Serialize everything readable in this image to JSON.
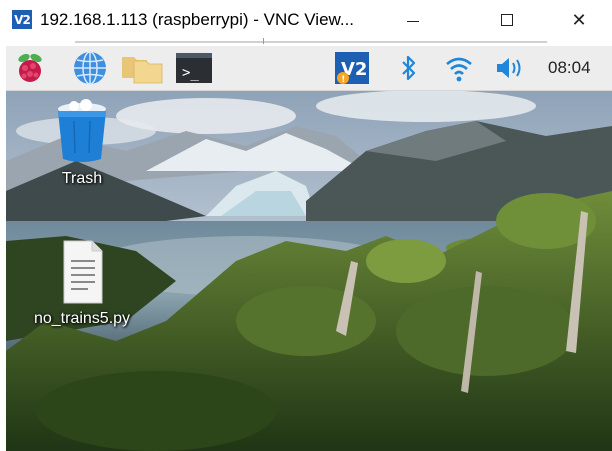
{
  "window": {
    "app_icon_text": "V2",
    "title": "192.168.1.113 (raspberrypi) - VNC View...",
    "minimize_label": "",
    "maximize_label": "",
    "close_label": "✕"
  },
  "panel": {
    "items": [
      {
        "name": "raspberry-menu-icon"
      },
      {
        "name": "web-browser-icon"
      },
      {
        "name": "file-manager-icon"
      },
      {
        "name": "terminal-icon",
        "glyph": ">_"
      },
      {
        "name": "vnc-server-icon"
      },
      {
        "name": "bluetooth-icon"
      },
      {
        "name": "wifi-icon"
      },
      {
        "name": "volume-icon"
      }
    ],
    "clock": "08:04"
  },
  "desktop": {
    "icons": [
      {
        "label": "Trash",
        "icon": "trash-icon"
      },
      {
        "label": "no_trains5.py",
        "icon": "python-file-icon"
      }
    ]
  },
  "colors": {
    "panel_bg": "#ededed",
    "vnc_blue": "#1e5fb3",
    "tray_blue": "#1f86d9"
  }
}
